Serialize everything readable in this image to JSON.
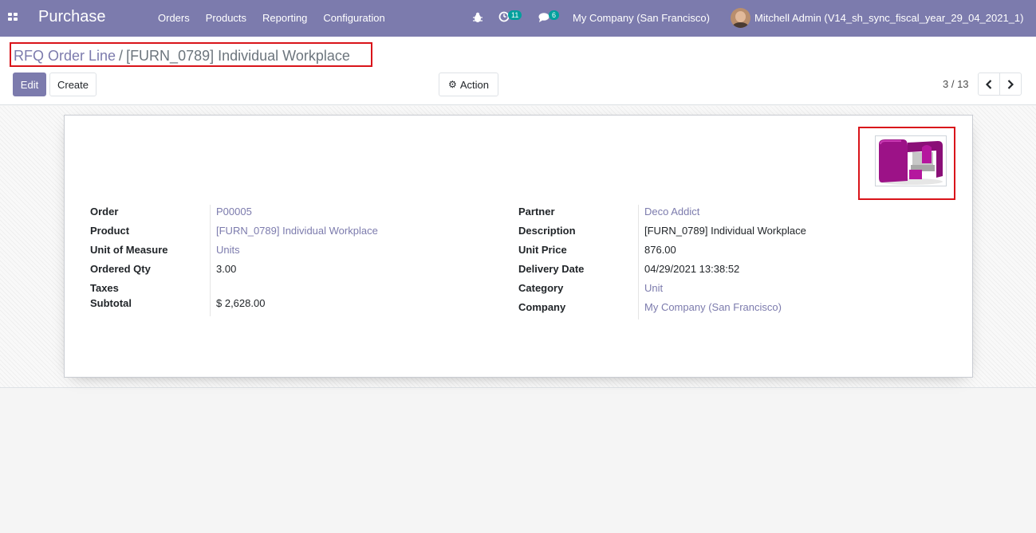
{
  "app": {
    "brand": "Purchase"
  },
  "menu": [
    "Orders",
    "Products",
    "Reporting",
    "Configuration"
  ],
  "systray": {
    "activity_count": "11",
    "messages_count": "6",
    "company": "My Company (San Francisco)",
    "user": "Mitchell Admin (V14_sh_sync_fiscal_year_29_04_2021_1)"
  },
  "breadcrumb": {
    "parent": "RFQ Order Line",
    "separator": "/",
    "current": "[FURN_0789] Individual Workplace"
  },
  "buttons": {
    "edit": "Edit",
    "create": "Create",
    "action": "Action"
  },
  "pager": {
    "value": "3 / 13"
  },
  "left_fields": [
    {
      "label": "Order",
      "value": "P00005",
      "link": true
    },
    {
      "label": "Product",
      "value": "[FURN_0789] Individual Workplace",
      "link": true
    },
    {
      "label": "Unit of Measure",
      "value": "Units",
      "link": true
    },
    {
      "label": "Ordered Qty",
      "value": "3.00",
      "link": false
    },
    {
      "label": "Taxes",
      "value": "",
      "link": false
    },
    {
      "label": "Subtotal",
      "value": "$ 2,628.00",
      "link": false
    }
  ],
  "right_fields": [
    {
      "label": "Partner",
      "value": "Deco Addict",
      "link": true
    },
    {
      "label": "Description",
      "value": "[FURN_0789] Individual Workplace",
      "link": false
    },
    {
      "label": "Unit Price",
      "value": "876.00",
      "link": false
    },
    {
      "label": "Delivery Date",
      "value": "04/29/2021 13:38:52",
      "link": false
    },
    {
      "label": "Category",
      "value": "Unit",
      "link": true
    },
    {
      "label": "Company",
      "value": "My Company (San Francisco)",
      "link": true
    }
  ],
  "colors": {
    "navbar": "#7c7bad",
    "link": "#7c7bad",
    "highlight_border": "#d9141a",
    "product_color": "#9c1287"
  }
}
